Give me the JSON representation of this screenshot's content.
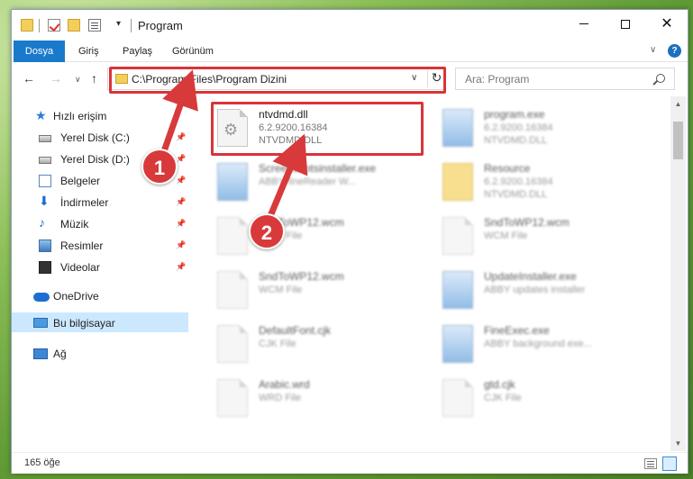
{
  "window": {
    "title": "Program"
  },
  "ribbon": {
    "tabs": [
      "Dosya",
      "Giriş",
      "Paylaş",
      "Görünüm"
    ],
    "help": "?",
    "expand": "∨"
  },
  "nav": {
    "back": "←",
    "forward": "→",
    "recent": "∨",
    "up": "↑"
  },
  "address": {
    "path": "C:\\Program Files\\Program Dizini",
    "dropdown": "∨",
    "refresh": "↻"
  },
  "search": {
    "placeholder": "Ara: Program"
  },
  "sidebar": {
    "items": [
      {
        "label": "Hızlı erişim"
      },
      {
        "label": "Yerel Disk (C:)"
      },
      {
        "label": "Yerel Disk (D:)"
      },
      {
        "label": "Belgeler"
      },
      {
        "label": "İndirmeler"
      },
      {
        "label": "Müzik"
      },
      {
        "label": "Resimler"
      },
      {
        "label": "Videolar"
      },
      {
        "label": "OneDrive"
      },
      {
        "label": "Bu bilgisayar"
      },
      {
        "label": "Ağ"
      }
    ]
  },
  "files": [
    {
      "name": "ntvdmd.dll",
      "line2": "6.2.9200.16384",
      "line3": "NTVDMD.DLL",
      "icon": "dll-gear-icon"
    },
    {
      "name": "program.exe",
      "line2": "6.2.9200.16384",
      "line3": "NTVDMD.DLL",
      "icon": "exe-icon"
    },
    {
      "name": "Screenshotsinstaller.exe",
      "line2": "ABBY fineReader W...",
      "line3": "",
      "icon": "exe-icon"
    },
    {
      "name": "Resource",
      "line2": "6.2.9200.16384",
      "line3": "NTVDMD.DLL",
      "icon": "folder-icon"
    },
    {
      "name": "SndToWP12.wcm",
      "line2": "WCM File",
      "line3": "",
      "icon": "file-icon"
    },
    {
      "name": "SndToWP12.wcm",
      "line2": "WCM File",
      "line3": "",
      "icon": "file-icon"
    },
    {
      "name": "SndToWP12.wcm",
      "line2": "WCM File",
      "line3": "",
      "icon": "file-icon"
    },
    {
      "name": "UpdateInstaller.exe",
      "line2": "ABBY updates installer",
      "line3": "",
      "icon": "exe-icon"
    },
    {
      "name": "DefaultFont.cjk",
      "line2": "CJK File",
      "line3": "",
      "icon": "file-icon"
    },
    {
      "name": "FineExec.exe",
      "line2": "ABBY background exe...",
      "line3": "",
      "icon": "exe-icon"
    },
    {
      "name": "Arabic.wrd",
      "line2": "WRD File",
      "line3": "",
      "icon": "file-icon"
    },
    {
      "name": "gtd.cjk",
      "line2": "CJK File",
      "line3": "",
      "icon": "file-icon"
    }
  ],
  "status": {
    "count": "165 öğe"
  },
  "markers": {
    "one": "1",
    "two": "2"
  },
  "colors": {
    "accent": "#1979ca",
    "highlight": "#d8343a",
    "selected_bg": "#cce8ff"
  }
}
